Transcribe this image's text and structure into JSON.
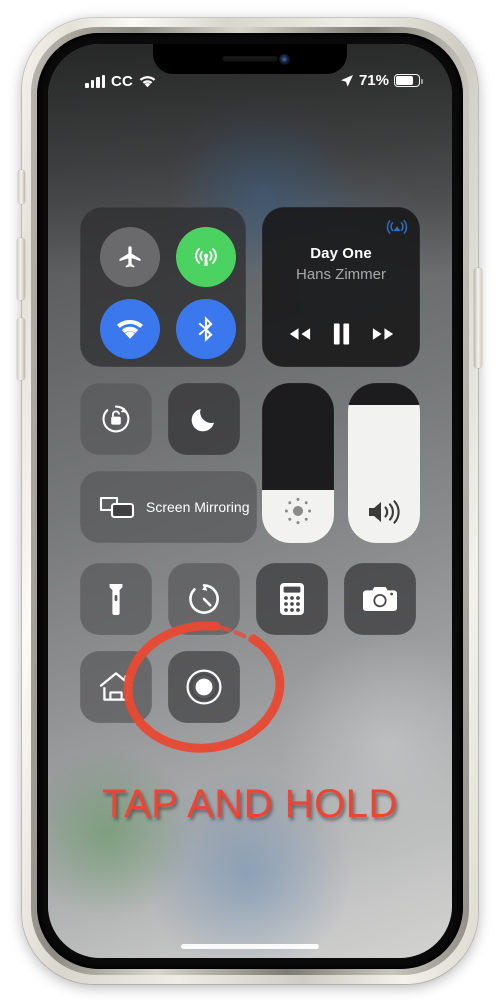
{
  "device": {
    "name": "iphone-x",
    "frame_color": "#e9e6de",
    "screen_bg": "#76797a"
  },
  "status_bar": {
    "signal_icon": "cellular-bars-icon",
    "signal_bars": 4,
    "carrier": "CC",
    "wifi_icon": "wifi-icon",
    "location_icon": "location-arrow-icon",
    "battery_percent": "71%",
    "battery_level": 0.71,
    "battery_icon": "battery-icon"
  },
  "control_center": {
    "connectivity": {
      "airplane": {
        "label": "Airplane Mode",
        "icon": "airplane-icon",
        "state": "off",
        "color": "#6a6a6c"
      },
      "cellular": {
        "label": "Cellular Data",
        "icon": "cellular-tower-icon",
        "state": "on",
        "color": "#4cd261"
      },
      "wifi": {
        "label": "Wi-Fi",
        "icon": "wifi-icon",
        "state": "on",
        "color": "#3b78ed"
      },
      "bluetooth": {
        "label": "Bluetooth",
        "icon": "bluetooth-icon",
        "state": "on",
        "color": "#3b78ed"
      }
    },
    "media": {
      "track_title": "Day One",
      "artist": "Hans Zimmer",
      "airplay_icon": "airplay-audio-icon",
      "airplay_color": "#2f6fc2",
      "rewind_icon": "rewind-icon",
      "pause_icon": "pause-icon",
      "forward_icon": "fast-forward-icon",
      "playback_state": "playing"
    },
    "rotation_lock": {
      "label": "Rotation Lock",
      "icon": "rotation-lock-icon",
      "state": "off"
    },
    "do_not_disturb": {
      "label": "Do Not Disturb",
      "icon": "moon-icon",
      "state": "off"
    },
    "screen_mirroring": {
      "label": "Screen Mirroring",
      "icon": "screen-mirroring-icon"
    },
    "brightness": {
      "label": "Brightness",
      "icon": "brightness-icon",
      "value": 33
    },
    "volume": {
      "label": "Volume",
      "icon": "speaker-waves-icon",
      "value": 86
    },
    "shortcuts": [
      {
        "name": "flashlight",
        "label": "Flashlight",
        "icon": "flashlight-icon"
      },
      {
        "name": "timer",
        "label": "Timer",
        "icon": "timer-icon"
      },
      {
        "name": "calculator",
        "label": "Calculator",
        "icon": "calculator-icon"
      },
      {
        "name": "camera",
        "label": "Camera",
        "icon": "camera-icon"
      },
      {
        "name": "home",
        "label": "Home",
        "icon": "home-icon"
      },
      {
        "name": "screen-recording",
        "label": "Screen Recording",
        "icon": "record-icon"
      }
    ],
    "home_indicator": "home-indicator"
  },
  "annotation": {
    "instruction": "TAP AND HOLD",
    "color": "#ee4433",
    "circle_target": "screen-recording"
  }
}
